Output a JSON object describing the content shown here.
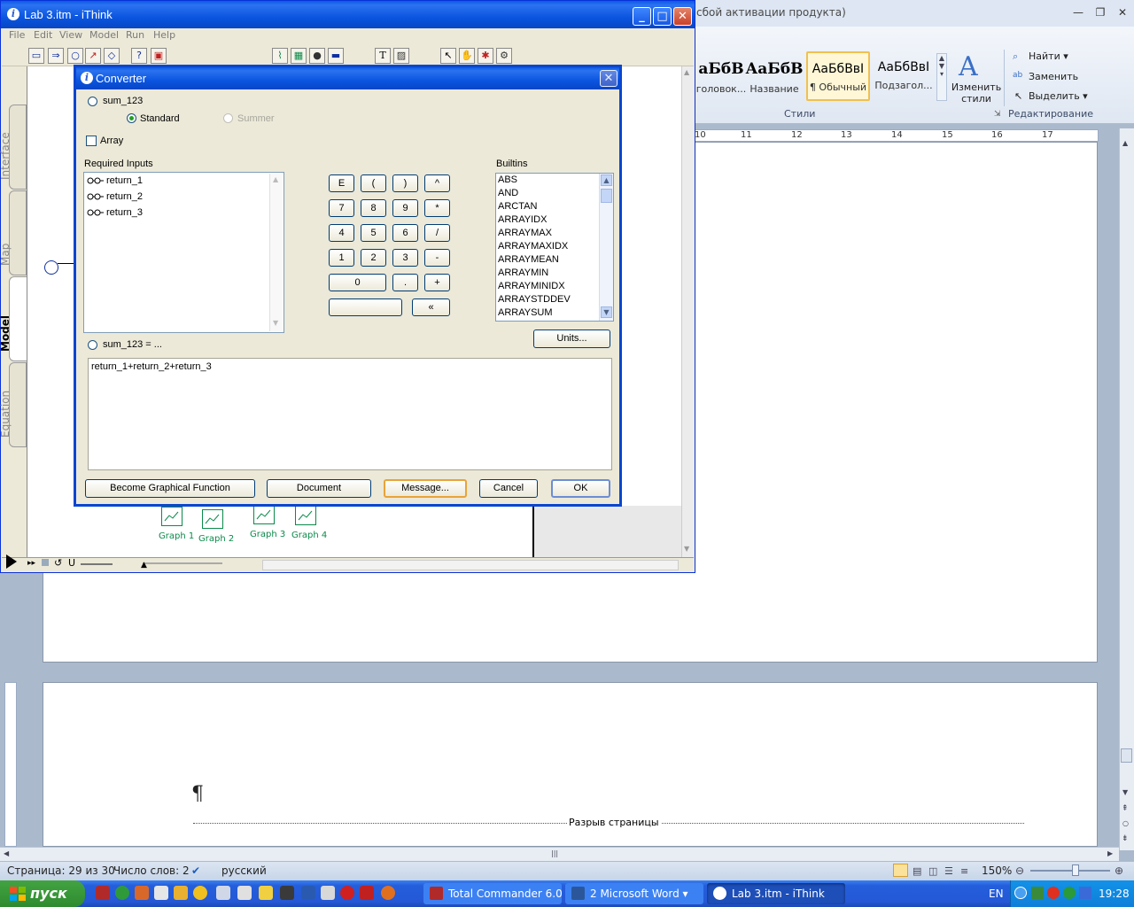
{
  "word": {
    "title_partial": "сбой активации продукта)",
    "styles": [
      {
        "preview": "аБбВ",
        "caption": "головок..."
      },
      {
        "preview": "АаБбВ",
        "caption": "Название"
      },
      {
        "preview": "АаБбВвI",
        "caption": "¶ Обычный"
      },
      {
        "preview": "АаБбВвI",
        "caption": "Подзагол..."
      }
    ],
    "change_styles": "Изменить стили",
    "group_styles": "Стили",
    "group_editing": "Редактирование",
    "find": "Найти",
    "replace": "Заменить",
    "select": "Выделить",
    "ruler_numbers": [
      "10",
      "11",
      "12",
      "13",
      "14",
      "15",
      "16",
      "17"
    ],
    "pilcrow": "¶",
    "page_break": "Разрыв страницы",
    "status": {
      "page": "Страница: 29 из 30",
      "words": "Число слов: 2",
      "language": "русский",
      "zoom": "150%"
    }
  },
  "taskbar": {
    "start": "пуск",
    "tasks": [
      {
        "label": "Total Commander 6.0...",
        "color": "#b02a2a"
      },
      {
        "label": "2 Microsoft Word",
        "color": "#2b579a"
      },
      {
        "label": "Lab 3.itm - iThink",
        "color": "#2d5fd6"
      }
    ],
    "language": "EN",
    "clock": "19:28"
  },
  "ithink": {
    "title": "Lab 3.itm - iThink",
    "menu": [
      "File",
      "Edit",
      "View",
      "Model",
      "Run",
      "Help"
    ],
    "tabs": [
      "Interface",
      "Map",
      "Model",
      "Equation"
    ],
    "graphs": [
      "Graph 1",
      "Graph 2",
      "Graph 3",
      "Graph 4"
    ],
    "toolbar_text_tool": "T",
    "toolbar_help": "?"
  },
  "dialog": {
    "title": "Converter",
    "name": "sum_123",
    "mode_standard": "Standard",
    "mode_summer": "Summer",
    "array": "Array",
    "required_inputs_label": "Required Inputs",
    "inputs": [
      "return_1",
      "return_2",
      "return_3"
    ],
    "builtins_label": "Builtins",
    "builtins": [
      "ABS",
      "AND",
      "ARCTAN",
      "ARRAYIDX",
      "ARRAYMAX",
      "ARRAYMAXIDX",
      "ARRAYMEAN",
      "ARRAYMIN",
      "ARRAYMINIDX",
      "ARRAYSTDDEV",
      "ARRAYSUM"
    ],
    "keypad": {
      "row1": [
        "E",
        "(",
        ")",
        "^"
      ],
      "row2": [
        "7",
        "8",
        "9",
        "*"
      ],
      "row3": [
        "4",
        "5",
        "6",
        "/"
      ],
      "row4": [
        "1",
        "2",
        "3",
        "-"
      ],
      "zero": "0",
      "dot": ".",
      "plus": "+",
      "backspace": "«"
    },
    "units": "Units...",
    "equation_label": "sum_123 = ...",
    "equation": "return_1+return_2+return_3",
    "buttons": {
      "graphical": "Become Graphical Function",
      "document": "Document",
      "message": "Message...",
      "cancel": "Cancel",
      "ok": "OK"
    }
  }
}
